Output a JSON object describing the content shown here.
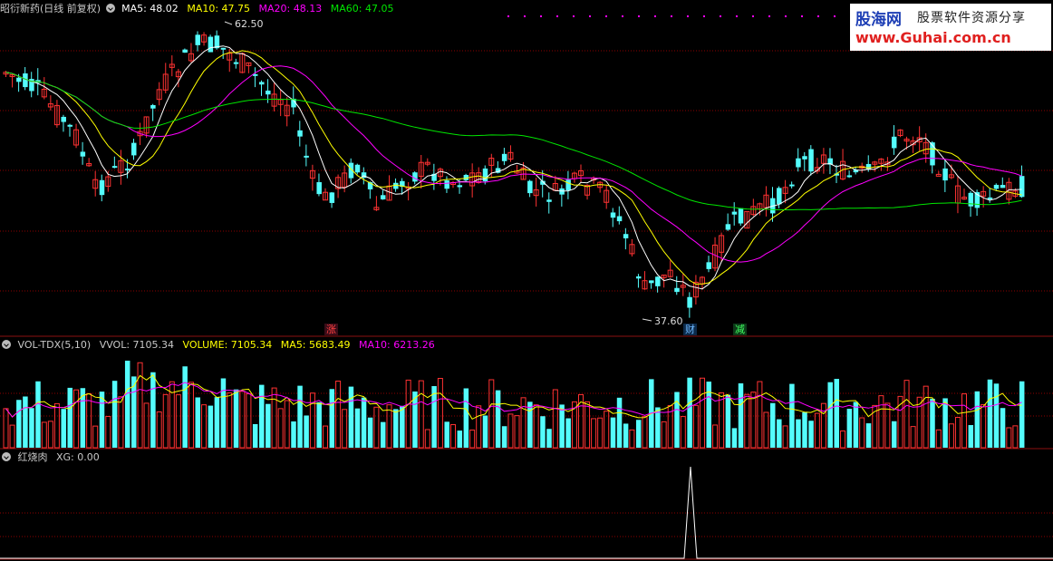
{
  "header": {
    "title": "昭衍新药(日线 前复权)",
    "ma5": "MA5: 48.02",
    "ma10": "MA10: 47.75",
    "ma20": "MA20: 48.13",
    "ma60": "MA60: 47.05"
  },
  "volume_header": {
    "title": "VOL-TDX(5,10)",
    "vvol": "VVOL: 7105.34",
    "volume": "VOLUME: 7105.34",
    "ma5": "MA5: 5683.49",
    "ma10": "MA10: 6213.26"
  },
  "indicator_header": {
    "title": "红烧肉",
    "xg": "XG: 0.00"
  },
  "watermark": {
    "brand": "股海网",
    "slogan": "股票软件资源分享",
    "url": "www.Guhai.com.cn"
  },
  "annotations": {
    "high": "62.50",
    "low": "37.60",
    "tag_zhang": "涨",
    "tag_cai": "财",
    "tag_jian": "减"
  },
  "colors": {
    "up": "#ff3232",
    "down": "#54fcfc",
    "ma5": "#ffffff",
    "ma10": "#ffff00",
    "ma20": "#ff00ff",
    "ma60": "#00e600",
    "grid": "#8b0000",
    "signal": "#ffffff"
  },
  "chart_data": [
    {
      "type": "candlestick",
      "title": "昭衍新药(日线 前复权)",
      "ylim": [
        37.6,
        62.5
      ],
      "series": [
        {
          "name": "MA5",
          "last": 48.02
        },
        {
          "name": "MA10",
          "last": 47.75
        },
        {
          "name": "MA20",
          "last": 48.13
        },
        {
          "name": "MA60",
          "last": 47.05
        }
      ],
      "annotations": [
        {
          "label": "62.50",
          "kind": "period-high"
        },
        {
          "label": "37.60",
          "kind": "period-low"
        }
      ],
      "grid": true
    },
    {
      "type": "bar",
      "title": "VOL-TDX(5,10)",
      "series": [
        {
          "name": "VOLUME",
          "last": 7105.34
        },
        {
          "name": "MA5",
          "last": 5683.49
        },
        {
          "name": "MA10",
          "last": 6213.26
        }
      ]
    },
    {
      "type": "line",
      "title": "红烧肉",
      "series": [
        {
          "name": "XG",
          "last": 0.0,
          "spikes": 1
        }
      ]
    }
  ]
}
